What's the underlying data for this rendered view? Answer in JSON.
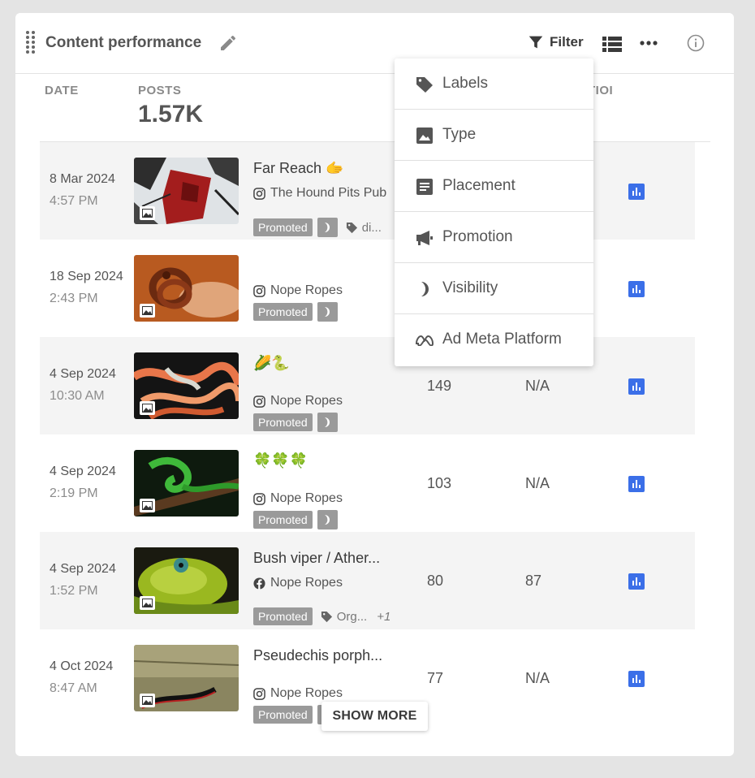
{
  "header": {
    "title": "Content performance",
    "filter_label": "Filter"
  },
  "columns": {
    "date": "DATE",
    "posts": "POSTS",
    "posts_total": "1.57K",
    "hidden_col_fragment": "TIOI"
  },
  "rows": [
    {
      "date": "8 Mar 2024",
      "time": "4:57 PM",
      "title": "Far Reach 🫱",
      "platform": "instagram",
      "account": "The Hound Pits Pub",
      "promoted": "Promoted",
      "label": "di...",
      "metric1": "",
      "metric2": ""
    },
    {
      "date": "18 Sep 2024",
      "time": "2:43 PM",
      "title": "",
      "platform": "instagram",
      "account": "Nope Ropes",
      "promoted": "Promoted",
      "label": "",
      "metric1": "",
      "metric2": ""
    },
    {
      "date": "4 Sep 2024",
      "time": "10:30 AM",
      "title": "🌽🐍",
      "platform": "instagram",
      "account": "Nope Ropes",
      "promoted": "Promoted",
      "label": "",
      "metric1": "149",
      "metric2": "N/A"
    },
    {
      "date": "4 Sep 2024",
      "time": "2:19 PM",
      "title": "🍀🍀🍀",
      "platform": "instagram",
      "account": "Nope Ropes",
      "promoted": "Promoted",
      "label": "",
      "metric1": "103",
      "metric2": "N/A"
    },
    {
      "date": "4 Sep 2024",
      "time": "1:52 PM",
      "title": "Bush viper / Ather...",
      "platform": "facebook",
      "account": "Nope Ropes",
      "promoted": "Promoted",
      "label": "Org...",
      "extra": "+1",
      "metric1": "80",
      "metric2": "87"
    },
    {
      "date": "4 Oct 2024",
      "time": "8:47 AM",
      "title": "Pseudechis porph...",
      "platform": "instagram",
      "account": "Nope Ropes",
      "promoted": "Promoted",
      "label": "",
      "metric1": "77",
      "metric2": "N/A"
    }
  ],
  "show_more": "SHOW MORE",
  "filter_menu": {
    "items": [
      {
        "label": "Labels",
        "icon": "tag-icon"
      },
      {
        "label": "Type",
        "icon": "image-icon"
      },
      {
        "label": "Placement",
        "icon": "document-icon"
      },
      {
        "label": "Promotion",
        "icon": "megaphone-icon"
      },
      {
        "label": "Visibility",
        "icon": "moon-icon"
      },
      {
        "label": "Ad Meta Platform",
        "icon": "meta-icon"
      }
    ]
  },
  "colors": {
    "accent": "#3b6fe8",
    "badge_gray": "#9a9a9a",
    "row_shade": "#f4f4f4"
  }
}
